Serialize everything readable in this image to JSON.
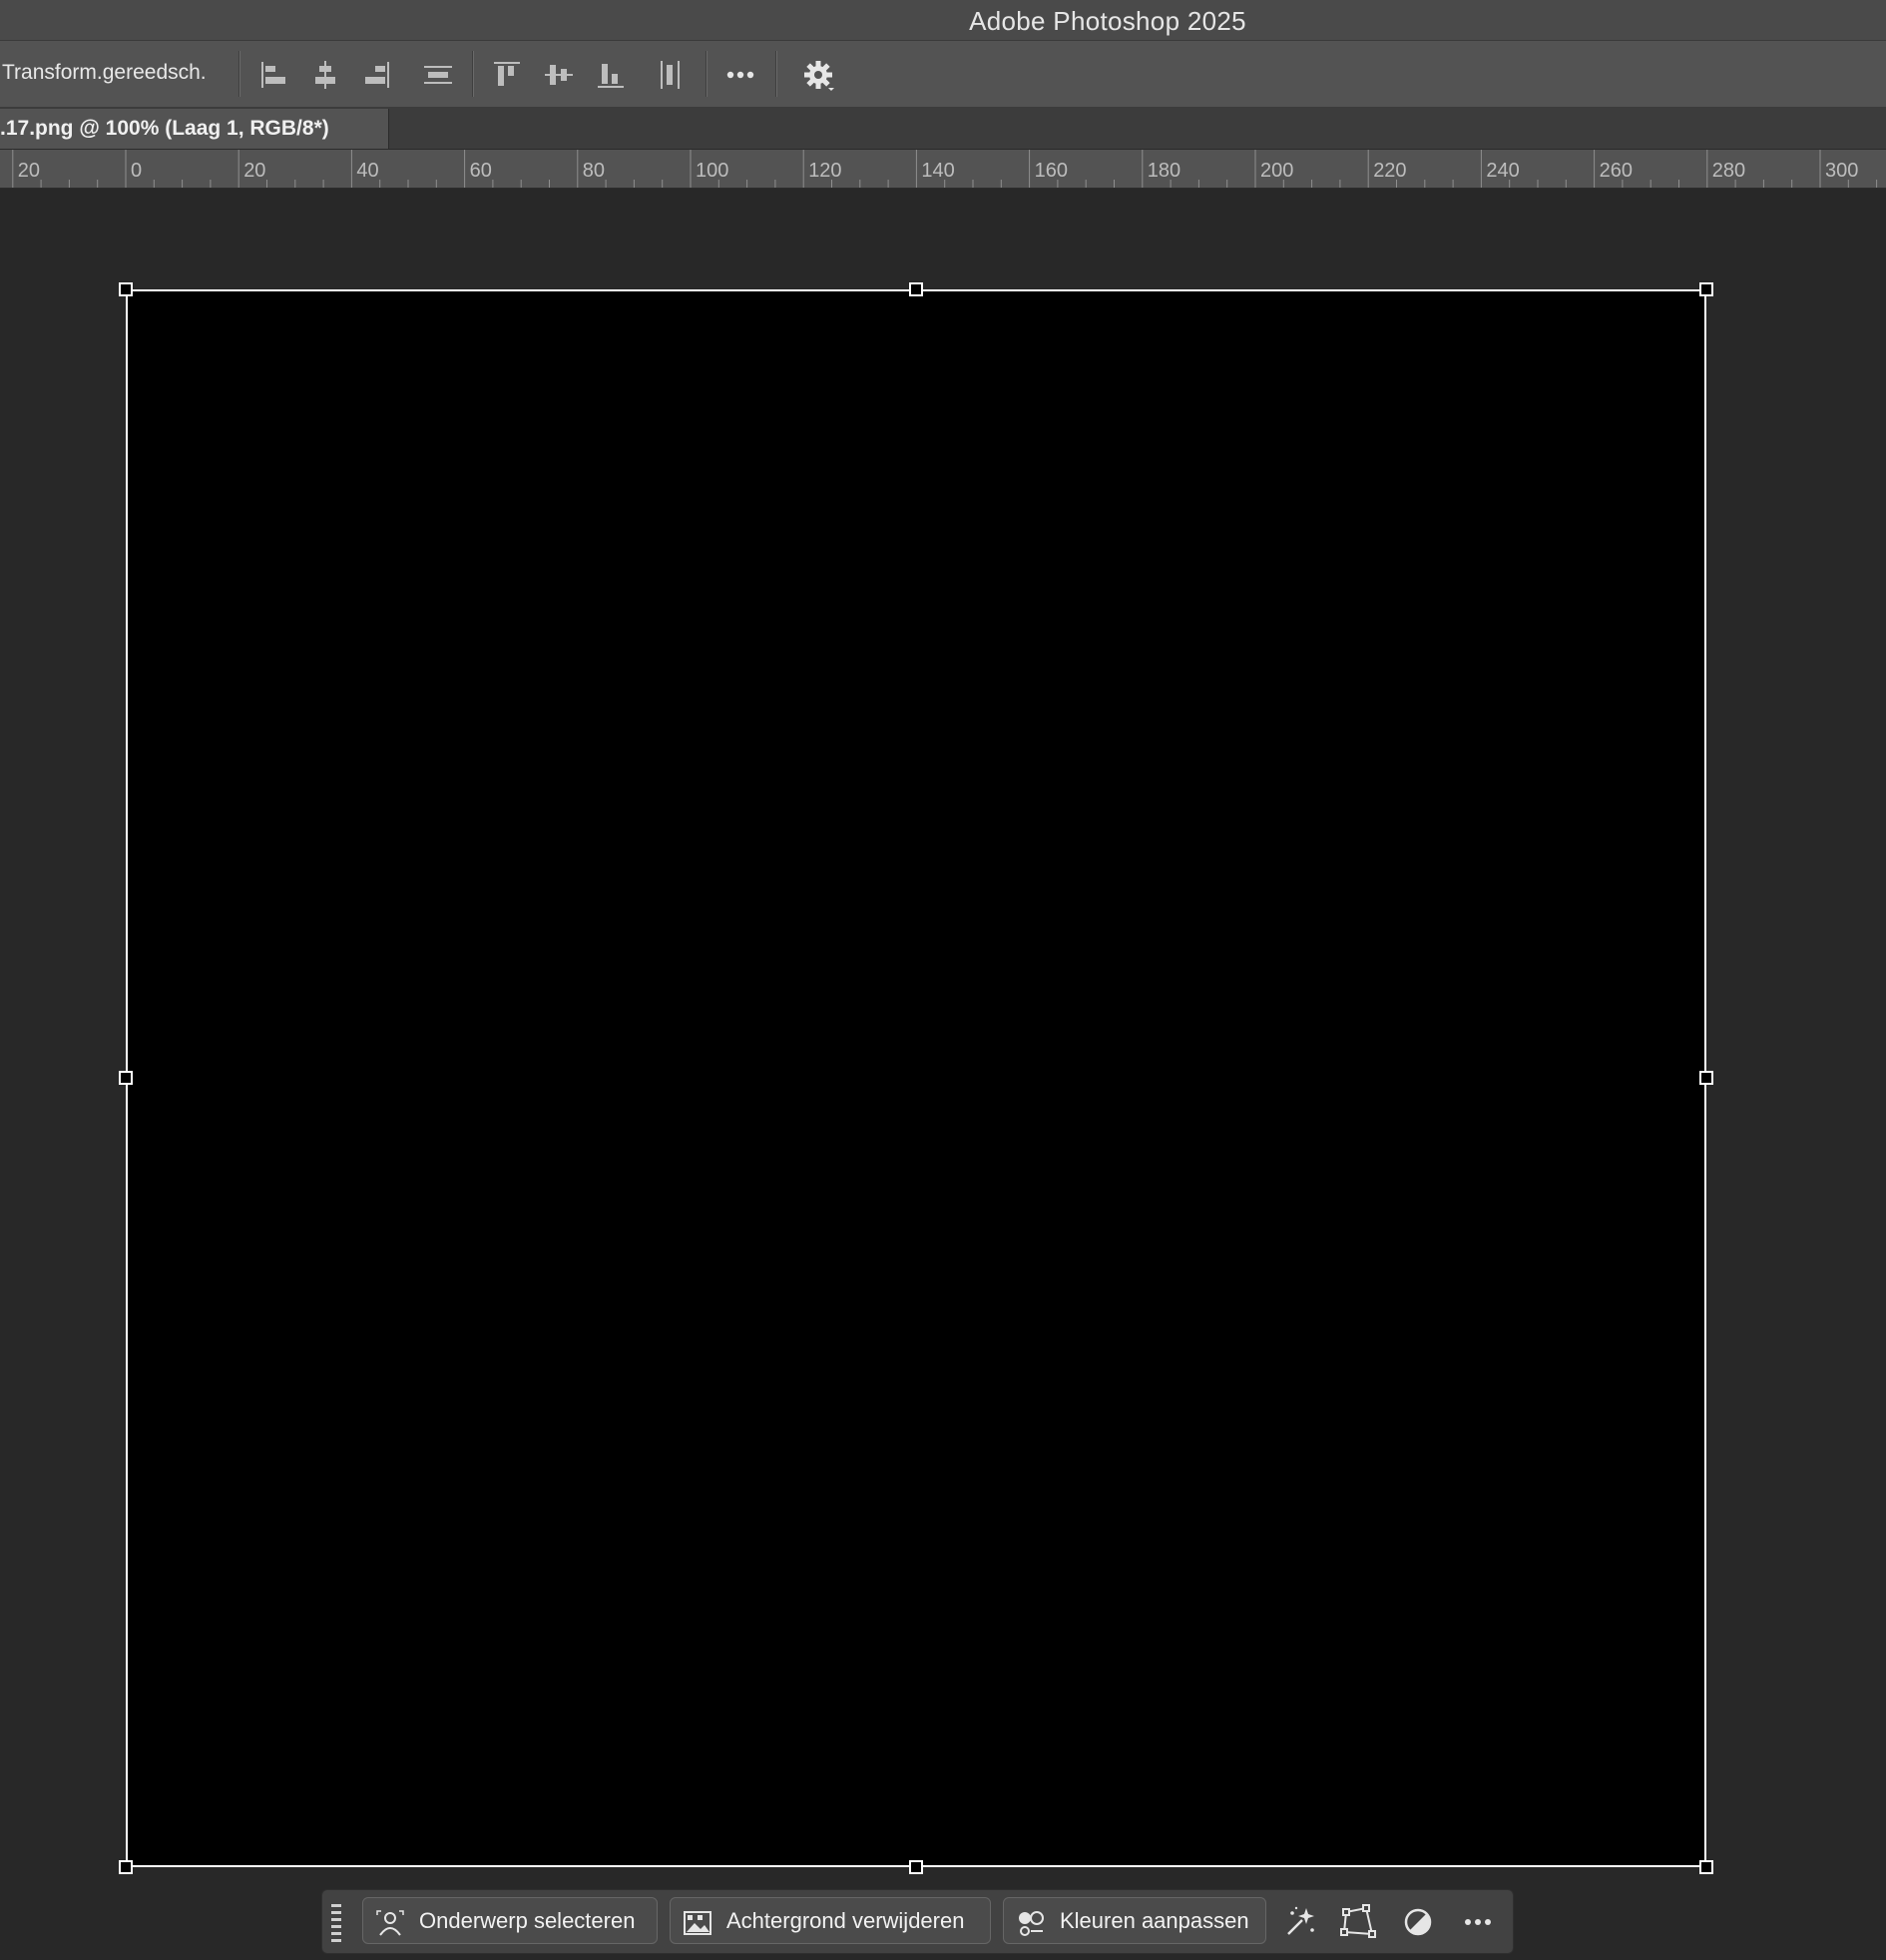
{
  "window": {
    "title": "Adobe Photoshop 2025"
  },
  "options_bar": {
    "transform_label": "Transform.gereedsch.",
    "buttons": [
      {
        "icon": "align-left-edges-icon"
      },
      {
        "icon": "align-horizontal-centers-icon"
      },
      {
        "icon": "align-right-edges-icon"
      },
      {
        "icon": "distribute-horizontally-icon"
      },
      {
        "icon": "align-top-edges-icon"
      },
      {
        "icon": "align-vertical-centers-icon"
      },
      {
        "icon": "align-bottom-edges-icon"
      },
      {
        "icon": "distribute-vertically-icon"
      },
      {
        "icon": "more-options-icon"
      },
      {
        "icon": "gear-icon"
      }
    ]
  },
  "document": {
    "tab_title": ".17.png @ 100% (Laag 1, RGB/8*)",
    "canvas_color": "#000000"
  },
  "ruler": {
    "labels": [
      "20",
      "0",
      "20",
      "40",
      "60",
      "80",
      "100",
      "120",
      "140",
      "160",
      "180",
      "200",
      "220",
      "240",
      "260",
      "280",
      "300"
    ]
  },
  "contextual_taskbar": {
    "select_subject": "Onderwerp selecteren",
    "remove_background": "Achtergrond verwijderen",
    "adjust_colors": "Kleuren aanpassen",
    "icons": [
      "generative-fill-icon",
      "transform-icon",
      "adjustment-icon",
      "more-icon"
    ]
  },
  "colors": {
    "workspace": "#282828",
    "panel": "#535353",
    "selection": "#ffffff"
  }
}
